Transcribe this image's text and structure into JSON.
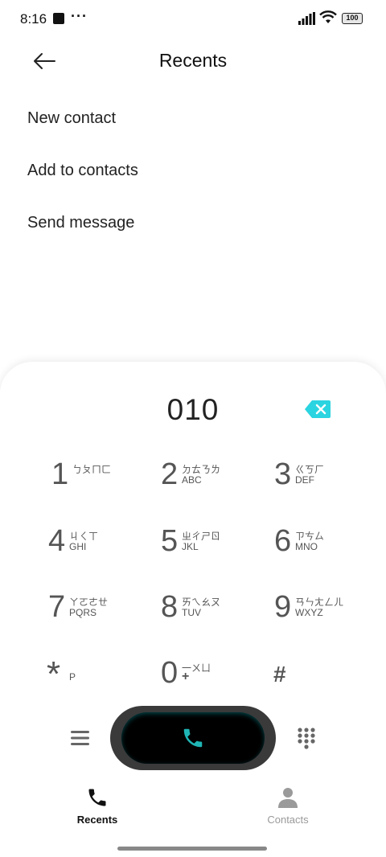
{
  "status_bar": {
    "time": "8:16",
    "dots": "···",
    "battery": "100"
  },
  "header": {
    "title": "Recents"
  },
  "menu": {
    "items": [
      {
        "label": "New contact"
      },
      {
        "label": "Add to contacts"
      },
      {
        "label": "Send message"
      }
    ]
  },
  "dialer": {
    "number": "010",
    "keys": [
      {
        "digit": "1",
        "top": "ㄅㄆㄇㄈ",
        "bottom": ""
      },
      {
        "digit": "2",
        "top": "ㄉㄊㄋㄌ",
        "bottom": "ABC"
      },
      {
        "digit": "3",
        "top": "ㄍㄎㄏ",
        "bottom": "DEF"
      },
      {
        "digit": "4",
        "top": "ㄐㄑㄒ",
        "bottom": "GHI"
      },
      {
        "digit": "5",
        "top": "ㄓㄔㄕㄖ",
        "bottom": "JKL"
      },
      {
        "digit": "6",
        "top": "ㄗㄘㄙ",
        "bottom": "MNO"
      },
      {
        "digit": "7",
        "top": "ㄚㄛㄜㄝ",
        "bottom": "PQRS"
      },
      {
        "digit": "8",
        "top": "ㄞㄟㄠㄡ",
        "bottom": "TUV"
      },
      {
        "digit": "9",
        "top": "ㄢㄣㄤㄥㄦ",
        "bottom": "WXYZ"
      },
      {
        "digit": "*",
        "top": "",
        "bottom": "P"
      },
      {
        "digit": "0",
        "top": "一ㄨㄩ",
        "bottom": "+"
      },
      {
        "digit": "#",
        "top": "",
        "bottom": ""
      }
    ]
  },
  "nav": {
    "recents_label": "Recents",
    "contacts_label": "Contacts"
  },
  "colors": {
    "accent": "#1fb5b5",
    "backspace": "#2ad4e0",
    "active_tab": "#111111",
    "inactive_tab": "#9a9a9a"
  }
}
